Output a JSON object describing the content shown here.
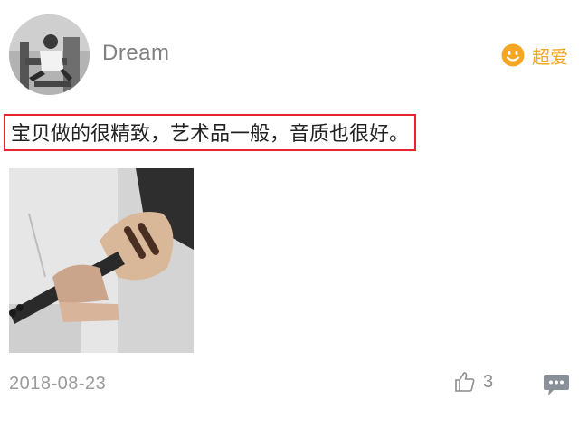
{
  "user": {
    "name": "Dream",
    "avatar_icon": "user-avatar-photo"
  },
  "rating": {
    "label": "超爱",
    "icon": "smiley-face-icon",
    "color": "#f5a623"
  },
  "review": {
    "text": "宝贝做的很精致，艺术品一般，音质也很好。",
    "highlight_color": "#e8232e"
  },
  "photo": {
    "icon": "ukulele-photo"
  },
  "footer": {
    "date": "2018-08-23",
    "like_icon": "thumbs-up-icon",
    "like_count": "3",
    "comment_icon": "comment-bubble-icon"
  }
}
